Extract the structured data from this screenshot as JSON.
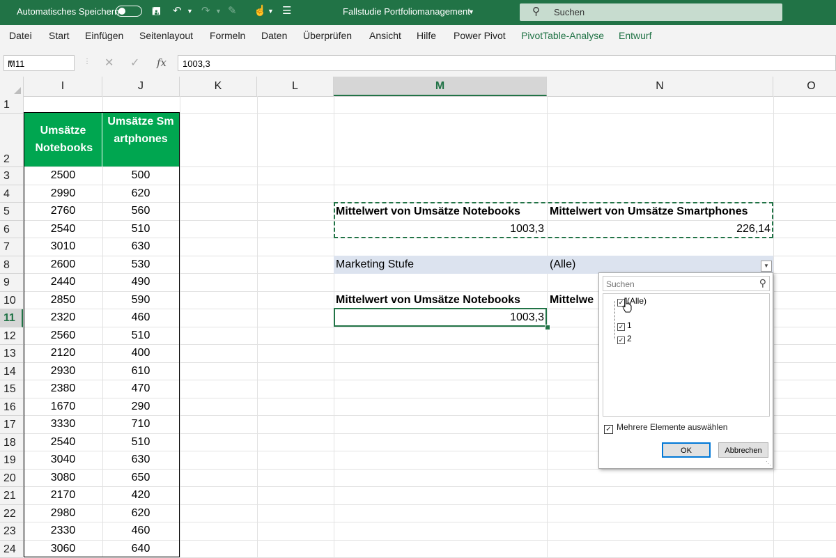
{
  "titlebar": {
    "autosave_label": "Automatisches Speichern",
    "doc_title": "Fallstudie Portfoliomanagement",
    "search_placeholder": "Suchen"
  },
  "menu": {
    "items": [
      "Datei",
      "Start",
      "Einfügen",
      "Seitenlayout",
      "Formeln",
      "Daten",
      "Überprüfen",
      "Ansicht",
      "Hilfe",
      "Power Pivot",
      "PivotTable-Analyse",
      "Entwurf"
    ]
  },
  "formula_bar": {
    "name_box": "M11",
    "content": "1003,3"
  },
  "columns": [
    "I",
    "J",
    "K",
    "L",
    "M",
    "N",
    "O"
  ],
  "rows": [
    "1",
    "2",
    "3",
    "4",
    "5",
    "6",
    "7",
    "8",
    "9",
    "10",
    "11",
    "12",
    "13",
    "14",
    "15",
    "16",
    "17",
    "18",
    "19",
    "20",
    "21",
    "22",
    "23",
    "24"
  ],
  "table": {
    "header_notebooks": "Umsätze Notebooks",
    "header_smartphones": "Umsätze Smartphones",
    "notebooks": [
      "2500",
      "2990",
      "2760",
      "2540",
      "3010",
      "2600",
      "2440",
      "2850",
      "2320",
      "2560",
      "2120",
      "2930",
      "2380",
      "1670",
      "3330",
      "2540",
      "3040",
      "3080",
      "2170",
      "2980",
      "2330",
      "3060"
    ],
    "smartphones": [
      "500",
      "620",
      "560",
      "510",
      "630",
      "530",
      "490",
      "590",
      "460",
      "510",
      "400",
      "610",
      "470",
      "290",
      "710",
      "510",
      "630",
      "650",
      "420",
      "620",
      "460",
      "640"
    ]
  },
  "pivot1": {
    "header_m": "Mittelwert von Umsätze Notebooks",
    "header_n": "Mittelwert von Umsätze Smartphones",
    "value_m": "1003,3",
    "value_n": "226,14"
  },
  "pivot2": {
    "filter_label": "Marketing Stufe",
    "filter_value": "(Alle)",
    "header_m": "Mittelwert von Umsätze Notebooks",
    "header_n_partial": "Mittelwe",
    "value_m": "1003,3"
  },
  "filter_popup": {
    "search_placeholder": "Suchen",
    "items": [
      "(Alle)",
      "1",
      "2"
    ],
    "multi_select_label": "Mehrere Elemente auswählen",
    "ok_label": "OK",
    "cancel_label": "Abbrechen"
  },
  "colors": {
    "excel_green": "#217346",
    "table_header_green": "#00a650",
    "filter_row_blue": "#dce3ef"
  }
}
